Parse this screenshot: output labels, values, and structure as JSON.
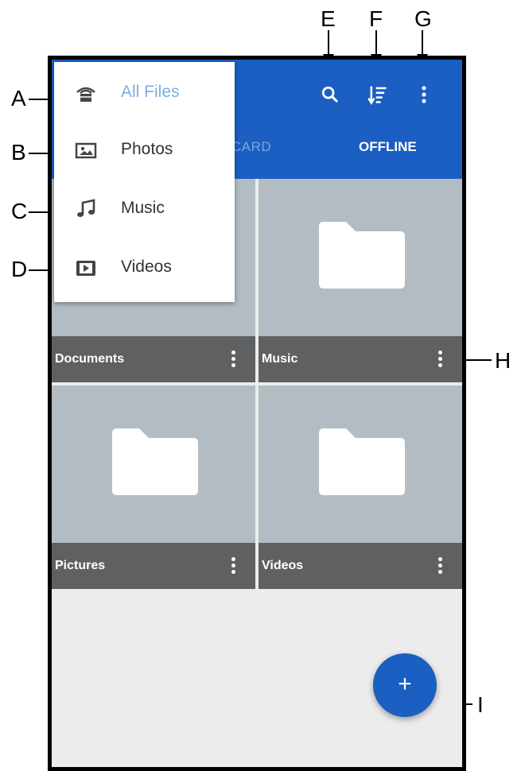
{
  "tabs": {
    "sd_card": "D CARD",
    "offline": "OFFLINE"
  },
  "toolbar": {
    "icons": [
      "search-icon",
      "sort-icon",
      "more-vert-icon"
    ]
  },
  "menu": {
    "items": [
      {
        "label": "All Files",
        "icon": "all-files-icon",
        "active": true
      },
      {
        "label": "Photos",
        "icon": "photos-icon",
        "active": false
      },
      {
        "label": "Music",
        "icon": "music-note-icon",
        "active": false
      },
      {
        "label": "Videos",
        "icon": "videos-icon",
        "active": false
      }
    ]
  },
  "folders": [
    {
      "name": "Documents"
    },
    {
      "name": "Music"
    },
    {
      "name": "Pictures"
    },
    {
      "name": "Videos"
    }
  ],
  "fab": {
    "label": "+"
  },
  "callouts": [
    "A",
    "B",
    "C",
    "D",
    "E",
    "F",
    "G",
    "H",
    "I"
  ],
  "colors": {
    "primary": "#1a5fc1",
    "tile": "#b3bcc2",
    "tile_bar": "#5e6062",
    "active_menu": "#7aaee5"
  }
}
